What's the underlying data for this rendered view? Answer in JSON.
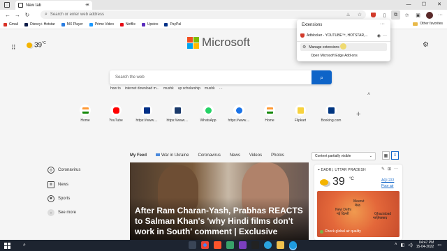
{
  "tab": {
    "title": "New tab",
    "new_tab_glyph": "+",
    "close_glyph": "×"
  },
  "window": {
    "minimize": "—",
    "maximize": "☐",
    "close": "✕"
  },
  "toolbar": {
    "back": "←",
    "forward": "→",
    "reload": "↻",
    "address_placeholder": "Search or enter web address"
  },
  "favorites": {
    "items": [
      {
        "label": "Gmail",
        "color": "#d93025"
      },
      {
        "label": "Disney+ Hotstar",
        "color": "#0b1a46"
      },
      {
        "label": "MX Player",
        "color": "#2a7de1"
      },
      {
        "label": "Prime Video",
        "color": "#1a98ff"
      },
      {
        "label": "Netflix",
        "color": "#e50914"
      },
      {
        "label": "Upstox",
        "color": "#5a2dbd"
      },
      {
        "label": "PayPal",
        "color": "#003087"
      }
    ],
    "other": "Other favorites"
  },
  "ext_popup": {
    "title": "Extensions",
    "more": "···",
    "ext_name": "Adblocker - YOUTUBE™, HOTSTAR,...",
    "manage": "Manage extensions",
    "addons": "Open Microsoft Edge Add-ons"
  },
  "newtab": {
    "weather_temp": "39",
    "weather_unit": "°C",
    "logo_text": "Microsoft",
    "logo_colors": [
      "#f25022",
      "#7fba00",
      "#00a4ef",
      "#ffb900"
    ],
    "search_placeholder": "Search the web",
    "search_icon": "search-icon",
    "trending": [
      "how to",
      "internet download m...",
      "mushk",
      "up scholarship",
      "mushk",
      "···"
    ],
    "collapse": "˄",
    "tiles": [
      {
        "label": "Home",
        "color": "#ff9933"
      },
      {
        "label": "YouTube",
        "color": "#ff0000"
      },
      {
        "label": "https://www....",
        "color": "#003087"
      },
      {
        "label": "https://www....",
        "color": "#1b3a6b"
      },
      {
        "label": "WhatsApp",
        "color": "#25d366"
      },
      {
        "label": "https://www....",
        "color": "#1a73e8"
      },
      {
        "label": "Home",
        "color": "#ff9933"
      },
      {
        "label": "Flipkart",
        "color": "#f7d23e"
      },
      {
        "label": "Booking.com",
        "color": "#003580"
      }
    ],
    "add_tile": "+"
  },
  "feed": {
    "tabs": [
      "My Feed",
      "War in Ukraine",
      "Coronavirus",
      "News",
      "Videos",
      "Photos"
    ],
    "content_select": "Content partially visible",
    "left_menu": [
      "Coronavirus",
      "News",
      "Sports",
      "See more"
    ],
    "headline": "After Ram Charan-Yash, Prabhas REACTS to Salman Khan's 'why Hindi films don't work in South' comment | Exclusive"
  },
  "weather_card": {
    "location": "DADRI, UTTAR PRADESH",
    "temp": "39",
    "unit": "°C",
    "aqi": "AQI 222",
    "aqi_text": "Poor air",
    "map_labels": [
      "Meerut",
      "मेरठ",
      "New Delhi",
      "नई दिल्ली",
      "Ghaziabad",
      "गाज़ियाबाद"
    ],
    "check": "Check global air quality",
    "more": "···",
    "edit": "✎"
  },
  "taskbar": {
    "time": "04:47 PM",
    "date": "15-04-2022",
    "search_glyph": "⌕"
  }
}
